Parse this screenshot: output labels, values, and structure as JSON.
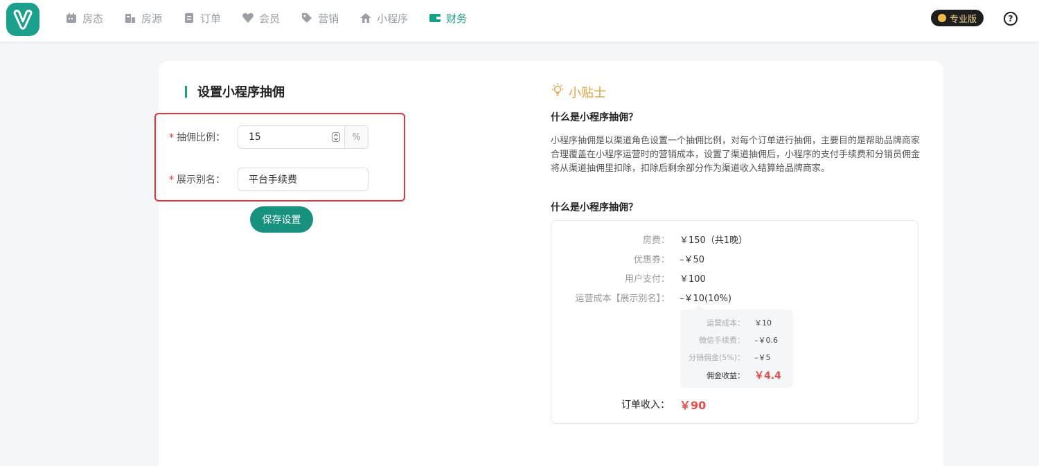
{
  "nav": {
    "items": [
      {
        "label": "房态",
        "icon": "calendar-icon"
      },
      {
        "label": "房源",
        "icon": "building-icon"
      },
      {
        "label": "订单",
        "icon": "clipboard-icon"
      },
      {
        "label": "会员",
        "icon": "heart-icon"
      },
      {
        "label": "营销",
        "icon": "tag-icon"
      },
      {
        "label": "小程序",
        "icon": "house-icon"
      },
      {
        "label": "财务",
        "icon": "wallet-icon"
      }
    ],
    "active_index": 6,
    "pro_badge": "专业版",
    "help": "?"
  },
  "form": {
    "title": "设置小程序抽佣",
    "rate_label": "抽佣比例：",
    "rate_value": "15",
    "rate_unit": "%",
    "alias_label": "展示别名：",
    "alias_value": "平台手续费",
    "required_mark": "*",
    "save_label": "保存设置"
  },
  "tips": {
    "title": "小贴士",
    "q1": "什么是小程序抽佣？",
    "a1": "小程序抽佣是以渠道角色设置一个抽佣比例，对每个订单进行抽佣，主要目的是帮助品牌商家合理覆盖在小程序运营时的营销成本，设置了渠道抽佣后，小程序的支付手续费和分销员佣金将从渠道抽佣里扣除，扣除后剩余部分作为渠道收入结算给品牌商家。",
    "q2": "什么是小程序抽佣？"
  },
  "calc": {
    "rows": [
      {
        "k": "房费：",
        "v": "￥150（共1晚）"
      },
      {
        "k": "优惠券：",
        "v": "–￥50"
      },
      {
        "k": "用户支付：",
        "v": "￥100"
      },
      {
        "k": "运营成本【展示别名】：",
        "v": "–￥10(10%)"
      }
    ],
    "sub_rows": [
      {
        "k": "运营成本：",
        "v": "￥10"
      },
      {
        "k": "微信手续费：",
        "v": "–￥0.6"
      },
      {
        "k": "分销佣金(5%)：",
        "v": "–￥5"
      },
      {
        "k": "佣金收益：",
        "v": "￥4.4"
      }
    ],
    "income_label": "订单收入：",
    "income_value": "￥90"
  }
}
